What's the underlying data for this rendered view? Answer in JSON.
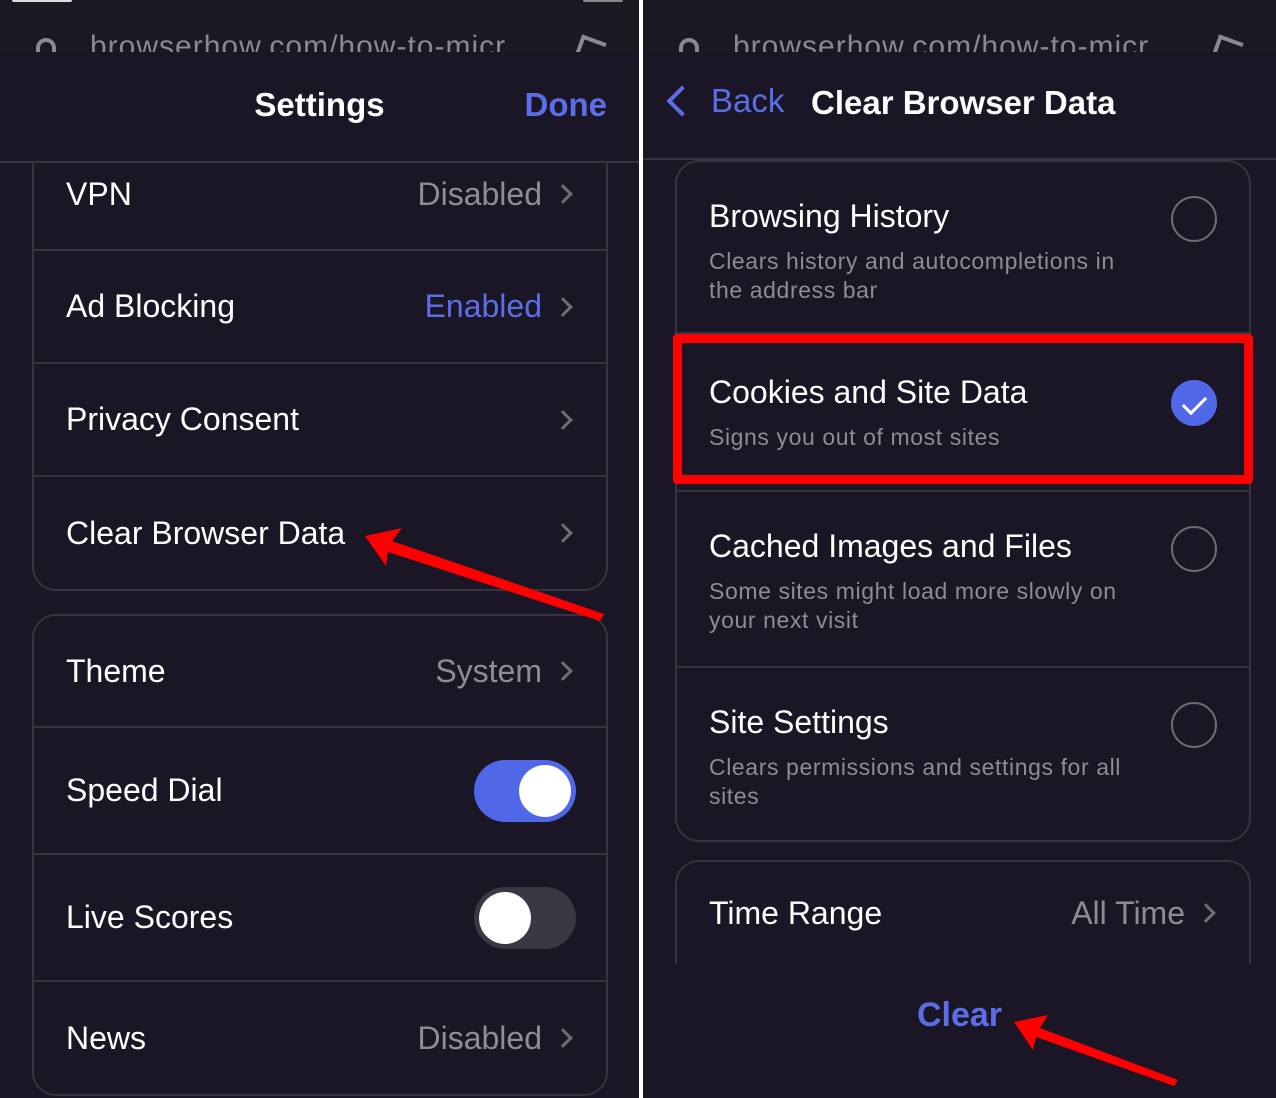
{
  "browser": {
    "url": "browserhow.com/how-to-micr"
  },
  "left_screen": {
    "title": "Settings",
    "done_label": "Done",
    "group1": [
      {
        "label": "VPN",
        "value": "Disabled",
        "value_style": "muted",
        "chevron": true
      },
      {
        "label": "Ad Blocking",
        "value": "Enabled",
        "value_style": "accent",
        "chevron": true
      },
      {
        "label": "Privacy Consent",
        "value": "",
        "chevron": true
      },
      {
        "label": "Clear Browser Data",
        "value": "",
        "chevron": true
      }
    ],
    "group2": [
      {
        "label": "Theme",
        "value": "System",
        "chevron": true
      },
      {
        "label": "Speed Dial",
        "toggle": true,
        "toggle_on": true
      },
      {
        "label": "Live Scores",
        "toggle": true,
        "toggle_on": false
      },
      {
        "label": "News",
        "value": "Disabled",
        "chevron": true
      }
    ]
  },
  "right_screen": {
    "back_label": "Back",
    "title": "Clear Browser Data",
    "options": [
      {
        "title": "Browsing History",
        "description": "Clears history and autocompletions in the address bar",
        "checked": false
      },
      {
        "title": "Cookies and Site Data",
        "description": "Signs you out of most sites",
        "checked": true
      },
      {
        "title": "Cached Images and Files",
        "description": "Some sites might load more slowly on your next visit",
        "checked": false
      },
      {
        "title": "Site Settings",
        "description": "Clears permissions and settings for all sites",
        "checked": false
      }
    ],
    "time_range": {
      "label": "Time Range",
      "value": "All Time"
    },
    "clear_label": "Clear"
  },
  "colors": {
    "background": "#1a1625",
    "accent": "#5b6ee8",
    "annotation": "#ff0000",
    "muted_text": "#8e8c96",
    "separator": "#35333f"
  }
}
